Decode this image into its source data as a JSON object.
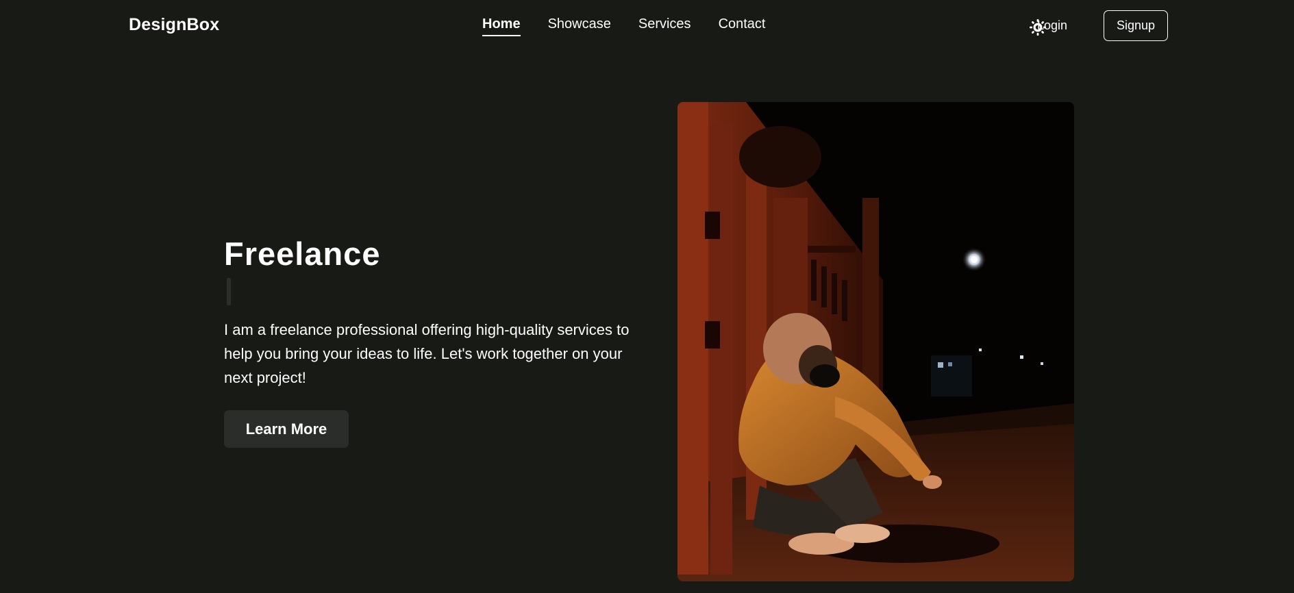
{
  "header": {
    "logo": "DesignBox",
    "nav": [
      {
        "label": "Home",
        "active": true
      },
      {
        "label": "Showcase",
        "active": false
      },
      {
        "label": "Services",
        "active": false
      },
      {
        "label": "Contact",
        "active": false
      }
    ],
    "theme_icon": "sun-icon",
    "login_label": "Login",
    "signup_label": "Signup"
  },
  "hero": {
    "title": "Freelance",
    "description": "I am a freelance professional offering high-quality services to help you bring your ideas to life. Let's work together on your next project!",
    "cta_label": "Learn More",
    "image_alt": "Person in a hoodie and face mask crouching on a street at night"
  },
  "colors": {
    "background": "#181a16",
    "text": "#ffffff",
    "button_bg": "#2a2d29"
  }
}
